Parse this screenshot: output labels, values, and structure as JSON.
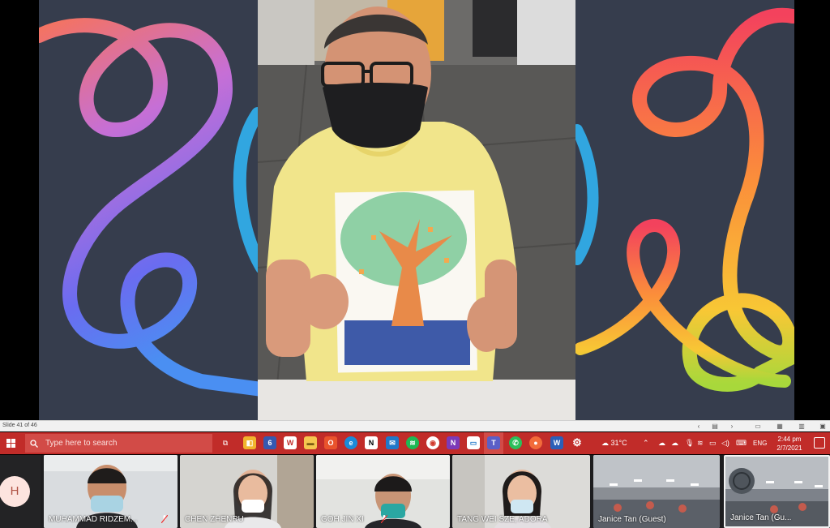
{
  "slide": {
    "counter": "Slide 41 of 46"
  },
  "taskbar": {
    "search_placeholder": "Type here to search",
    "apps": [
      "file-explorer-icon",
      "store-icon",
      "app-6-icon",
      "w-app-icon",
      "folder-icon",
      "office-icon",
      "edge-icon",
      "notion-icon",
      "mail-icon",
      "spotify-icon",
      "chrome-icon",
      "onenote-icon",
      "calendar-icon",
      "teams-icon",
      "whatsapp-icon",
      "app-orange-icon",
      "word-icon",
      "settings-icon"
    ],
    "weather": "31°C",
    "language": "ENG",
    "time": "2:44 pm",
    "date": "2/7/2021"
  },
  "participants": [
    {
      "initial": "H"
    },
    {
      "name": "MUHAMMAD RIDZEM..."
    },
    {
      "name": "CHEN ZHENRU"
    },
    {
      "name": "GOH JIN XI"
    },
    {
      "name": "TANG WEI SZE, ADORA"
    },
    {
      "name": "Janice Tan (Guest)"
    },
    {
      "name": "Janice Tan (Gu..."
    }
  ],
  "colors": {
    "taskbar": "#c12c29",
    "slide_bg": "#363d4d"
  }
}
